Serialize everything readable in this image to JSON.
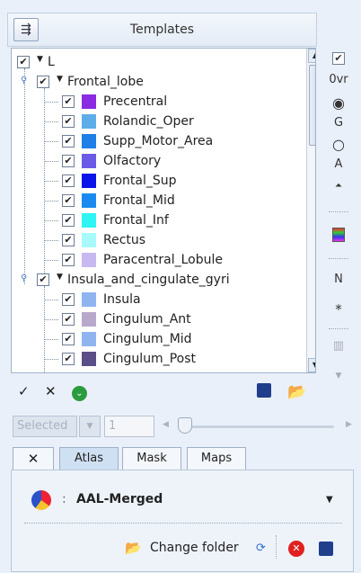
{
  "header": {
    "title": "Templates",
    "toggle_icon": "panel-toggle-icon"
  },
  "tree": {
    "root": {
      "label": "L",
      "checked": true
    },
    "groups": [
      {
        "label": "Frontal_lobe",
        "items": [
          {
            "label": "Precentral",
            "color": "#8a2be2"
          },
          {
            "label": "Rolandic_Oper",
            "color": "#5dade8"
          },
          {
            "label": "Supp_Motor_Area",
            "color": "#1e7fe6"
          },
          {
            "label": "Olfactory",
            "color": "#6a5ae6"
          },
          {
            "label": "Frontal_Sup",
            "color": "#0a14e8"
          },
          {
            "label": "Frontal_Mid",
            "color": "#1b8af0"
          },
          {
            "label": "Frontal_Inf",
            "color": "#2ff4f4"
          },
          {
            "label": "Rectus",
            "color": "#a8fafa"
          },
          {
            "label": "Paracentral_Lobule",
            "color": "#c7b8f0"
          }
        ]
      },
      {
        "label": "Insula_and_cingulate_gyri",
        "items": [
          {
            "label": "Insula",
            "color": "#8fb4f0"
          },
          {
            "label": "Cingulum_Ant",
            "color": "#b8a8cc"
          },
          {
            "label": "Cingulum_Mid",
            "color": "#8fb4f0"
          },
          {
            "label": "Cingulum_Post",
            "color": "#5c4e86"
          }
        ]
      }
    ]
  },
  "side_toolbar": {
    "ovr_label": "0vr",
    "g_label": "G",
    "a_label": "A",
    "n_label": "N",
    "asterisk_label": "*"
  },
  "tools": {
    "check_glyph": "✓",
    "x_glyph": "✕"
  },
  "selection": {
    "mode_placeholder": "Selected",
    "value": "1"
  },
  "tabs": [
    {
      "label": "✕"
    },
    {
      "label": "Atlas"
    },
    {
      "label": "Mask"
    },
    {
      "label": "Maps"
    }
  ],
  "atlas": {
    "separator": ":",
    "name": "AAL-Merged",
    "change_folder_label": "Change folder"
  }
}
